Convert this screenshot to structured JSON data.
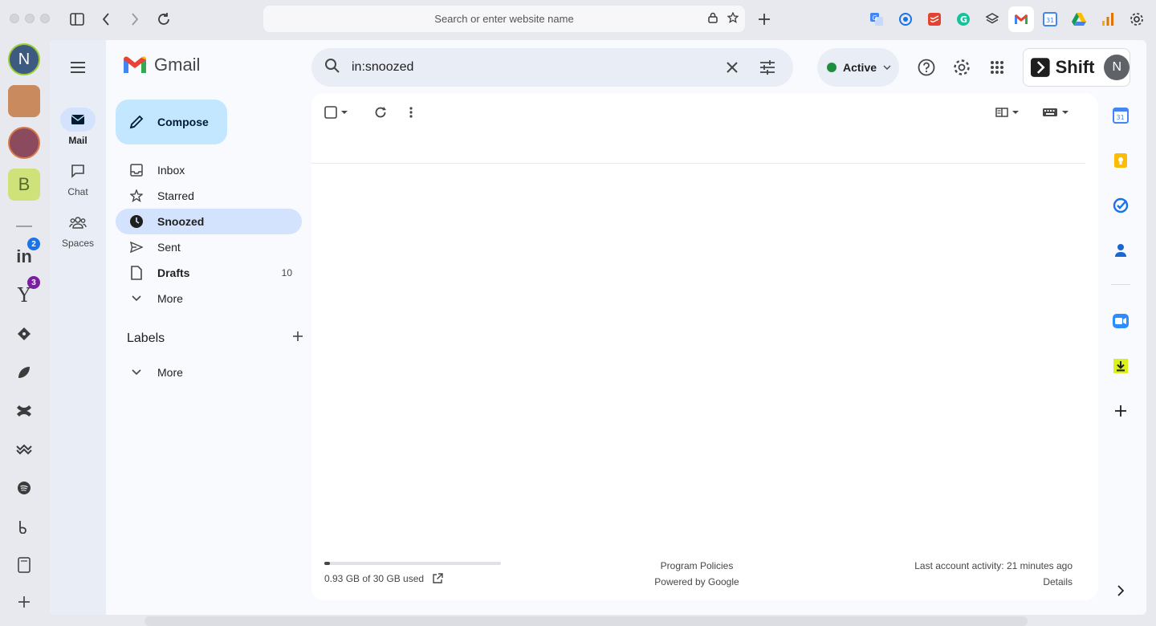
{
  "browser": {
    "url_placeholder": "Search or enter website name"
  },
  "dock": {
    "avatar_letter": "N",
    "b_letter": "B",
    "linkedin_label": "in",
    "linkedin_badge": "2",
    "yahoo_label": "Y",
    "yahoo_badge": "3"
  },
  "gmail": {
    "logo_text": "Gmail",
    "rail": [
      {
        "label": "Mail"
      },
      {
        "label": "Chat"
      },
      {
        "label": "Spaces"
      }
    ],
    "compose_label": "Compose",
    "nav": [
      {
        "label": "Inbox",
        "count": ""
      },
      {
        "label": "Starred",
        "count": ""
      },
      {
        "label": "Snoozed",
        "count": ""
      },
      {
        "label": "Sent",
        "count": ""
      },
      {
        "label": "Drafts",
        "count": "10"
      },
      {
        "label": "More",
        "count": ""
      }
    ],
    "labels_heading": "Labels",
    "labels_more": "More",
    "search_value": "in:snoozed",
    "status_label": "Active",
    "shift_label": "Shift",
    "account_letter": "N",
    "storage": {
      "used_fraction": 0.031,
      "text": "0.93 GB of 30 GB used"
    },
    "footer": {
      "program_policies": "Program Policies",
      "powered_by": "Powered by Google",
      "last_activity": "Last account activity: 21 minutes ago",
      "details": "Details"
    },
    "calendar_day": "31"
  },
  "colors": {
    "accent": "#0b57d0",
    "compose_bg": "#c2e7ff",
    "selected_bg": "#d3e3fd",
    "status_green": "#1e8e3e"
  }
}
